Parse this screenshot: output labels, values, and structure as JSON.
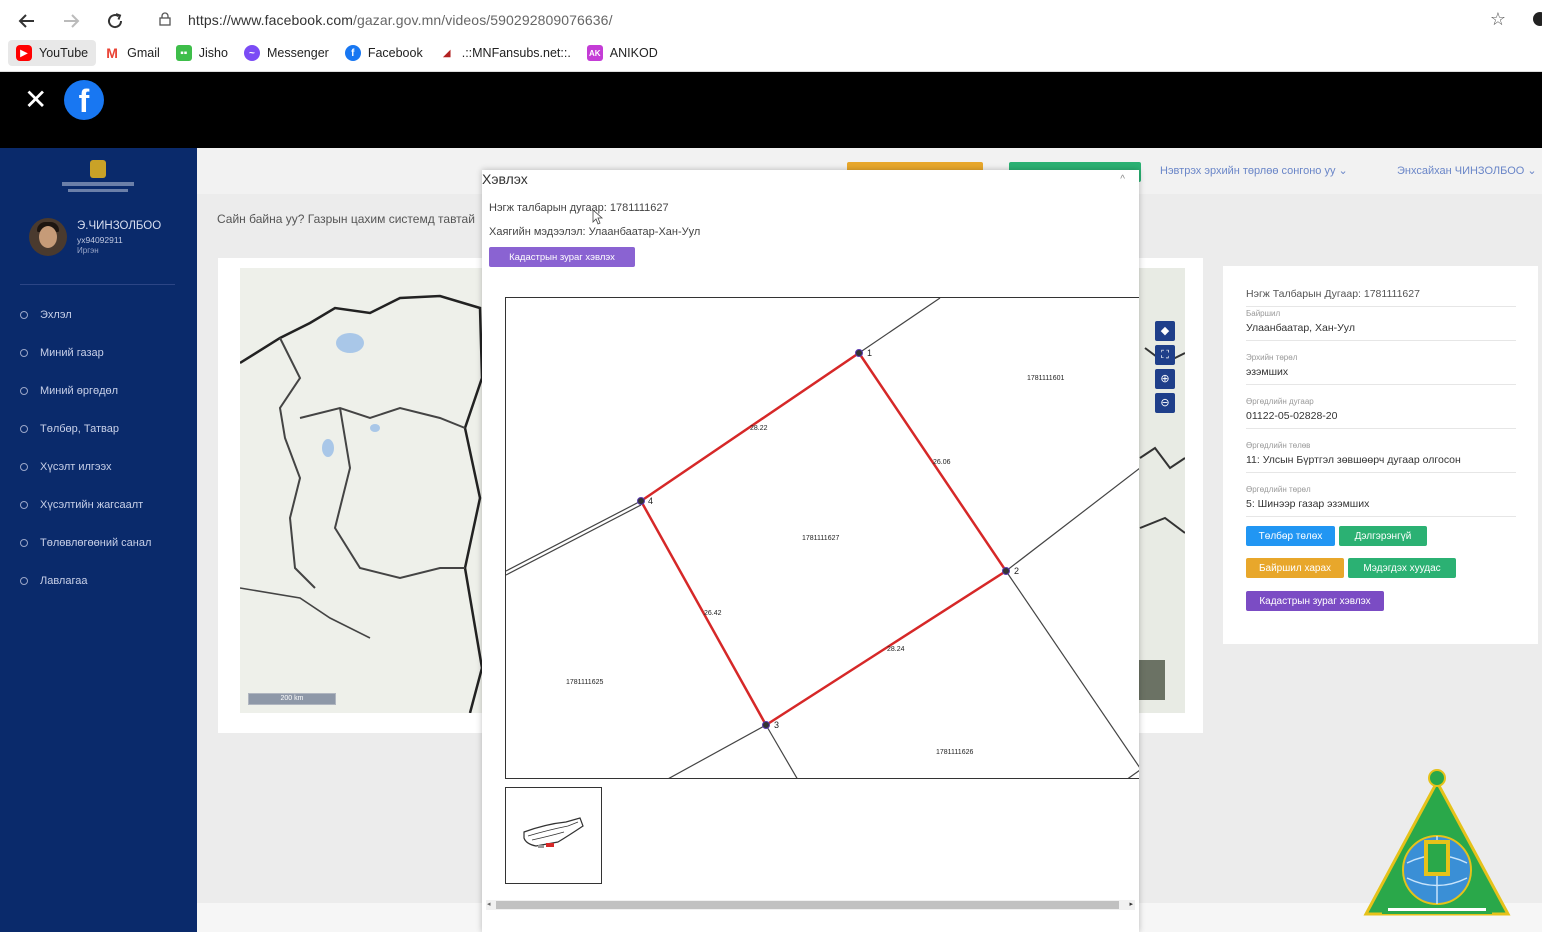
{
  "browser": {
    "url_host": "https://www.facebook.com",
    "url_path": "/gazar.gov.mn/videos/590292809076636/",
    "bookmarks": [
      {
        "label": "YouTube",
        "icon": "youtube-icon",
        "color": "#ff0000"
      },
      {
        "label": "Gmail",
        "icon": "gmail-icon",
        "color": "#ea4335"
      },
      {
        "label": "Jisho",
        "icon": "jisho-icon",
        "color": "#3ebe4a"
      },
      {
        "label": "Messenger",
        "icon": "messenger-icon",
        "color": "#7b4cf5"
      },
      {
        "label": "Facebook",
        "icon": "facebook-icon",
        "color": "#1877f2"
      },
      {
        "label": ".::MNFansubs.net::.",
        "icon": "mnfansubs-icon",
        "color": "#b22222"
      },
      {
        "label": "ANIKOD",
        "icon": "anikod-icon",
        "color": "#c43cd6"
      }
    ]
  },
  "app": {
    "user_name": "Э.ЧИНЗОЛБОО",
    "user_id": "ух94092911",
    "user_role": "Иргэн",
    "menu": [
      "Эхлэл",
      "Миний газар",
      "Миний өргөдөл",
      "Төлбөр, Татвар",
      "Хүсэлт илгээх",
      "Хүсэлтийн жагсаалт",
      "Төлөвлөгөөний санал",
      "Лавлагаа"
    ],
    "topbar_link1": "Нэвтрэх эрхийн төрлөө сонгоно уу",
    "topbar_link2": "Энхсайхан ЧИНЗОЛБОО",
    "welcome": "Сайн байна уу? Газрын цахим системд тавтай",
    "scale": "200 km",
    "info": {
      "title": "Нэгж Талбарын Дугаар: 1781111627",
      "fields": [
        {
          "label": "Байршил",
          "value": "Улаанбаатар, Хан-Уул"
        },
        {
          "label": "Эрхийн төрөл",
          "value": "эзэмших"
        },
        {
          "label": "Өргөдлийн дугаар",
          "value": "01122-05-02828-20"
        },
        {
          "label": "Өргөдлийн төлөв",
          "value": "11: Улсын Бүртгэл зөвшөөрч дугаар олгосон"
        },
        {
          "label": "Өргөдлийн төрөл",
          "value": "5: Шинээр газар эзэмших"
        }
      ],
      "btn_pay": "Төлбөр төлөх",
      "btn_detail": "Дэлгэрэнгүй",
      "btn_location": "Байршил харах",
      "btn_notice": "Мэдэгдэх хуудас",
      "btn_cadastre": "Кадастрын зураг хэвлэх"
    }
  },
  "modal": {
    "title": "Хэвлэх",
    "parcel_line": "Нэгж талбарын дугаар: 1781111627",
    "address_line": "Хаягийн мэдээлэл: Улаанбаатар-Хан-Уул",
    "print_button": "Кадастрын зураг хэвлэх",
    "plot": {
      "parcel": "1781111627",
      "neighbors": [
        "1781111601",
        "1781111625",
        "1781111626"
      ],
      "vertices": [
        "1",
        "2",
        "3",
        "4"
      ],
      "sides": [
        "28.22",
        "26.06",
        "28.24",
        "26.42"
      ]
    }
  },
  "colors": {
    "sidebar": "#0a2a6b",
    "boundary": "#d62828",
    "modal_button": "#8a63d2",
    "pay": "#2196f3",
    "detail": "#2bb173",
    "location": "#e8a72b",
    "cadastre": "#7b4cc4"
  }
}
